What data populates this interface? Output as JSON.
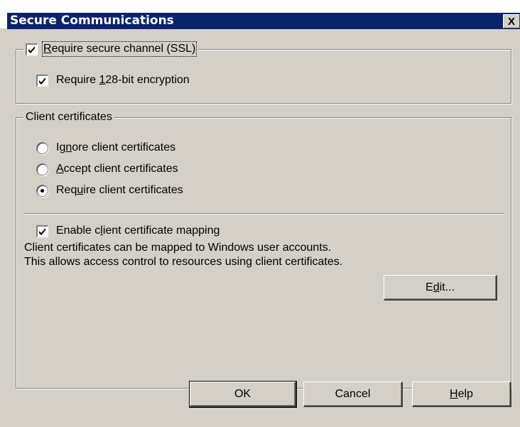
{
  "window": {
    "title": "Secure Communications",
    "close_glyph": "X"
  },
  "ssl_group": {
    "require_ssl": {
      "pre": "",
      "accel": "R",
      "post": "equire secure channel (SSL)",
      "checked": true
    },
    "require_128": {
      "pre": "Require ",
      "accel": "1",
      "post": "28-bit encryption",
      "checked": true
    }
  },
  "client_certs": {
    "legend": "Client certificates",
    "options": [
      {
        "pre": "Ig",
        "accel": "n",
        "post": "ore client certificates",
        "selected": false
      },
      {
        "pre": "",
        "accel": "A",
        "post": "ccept client certificates",
        "selected": false
      },
      {
        "pre": "Req",
        "accel": "u",
        "post": "ire client certificates",
        "selected": true
      }
    ],
    "mapping": {
      "pre": "Enable c",
      "accel": "l",
      "post": "ient certificate mapping",
      "checked": true
    },
    "description": "Client certificates can be mapped to Windows user accounts.  This allows access control to resources using client certificates.",
    "edit_button": {
      "pre": "E",
      "accel": "d",
      "post": "it..."
    }
  },
  "buttons": {
    "ok": "OK",
    "cancel": "Cancel",
    "help": {
      "pre": "",
      "accel": "H",
      "post": "elp"
    }
  },
  "colors": {
    "title_bar": "#0a246a",
    "dialog_bg": "#d4d0c8"
  }
}
